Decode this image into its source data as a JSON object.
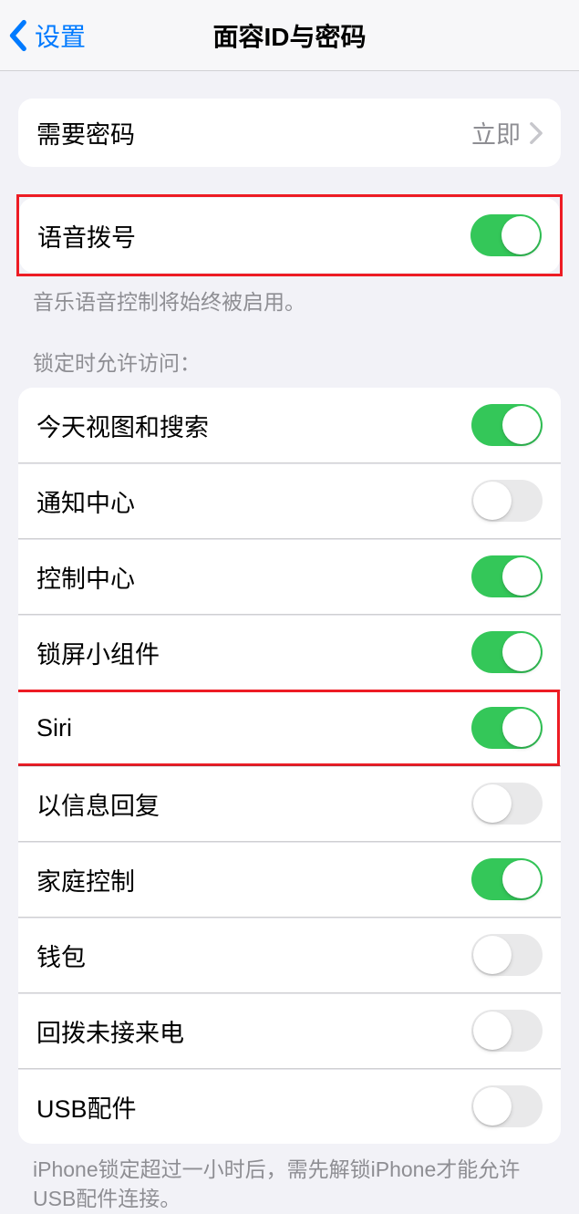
{
  "header": {
    "back_label": "设置",
    "title": "面容ID与密码"
  },
  "passcode_group": {
    "require_passcode": {
      "label": "需要密码",
      "value": "立即"
    }
  },
  "voice_dial": {
    "label": "语音拨号",
    "enabled": true,
    "footer": "音乐语音控制将始终被启用。"
  },
  "lock_access": {
    "header": "锁定时允许访问：",
    "items": [
      {
        "label": "今天视图和搜索",
        "enabled": true
      },
      {
        "label": "通知中心",
        "enabled": false
      },
      {
        "label": "控制中心",
        "enabled": true
      },
      {
        "label": "锁屏小组件",
        "enabled": true
      },
      {
        "label": "Siri",
        "enabled": true
      },
      {
        "label": "以信息回复",
        "enabled": false
      },
      {
        "label": "家庭控制",
        "enabled": true
      },
      {
        "label": "钱包",
        "enabled": false
      },
      {
        "label": "回拨未接来电",
        "enabled": false
      },
      {
        "label": "USB配件",
        "enabled": false
      }
    ],
    "footer": "iPhone锁定超过一小时后，需先解锁iPhone才能允许USB配件连接。"
  }
}
